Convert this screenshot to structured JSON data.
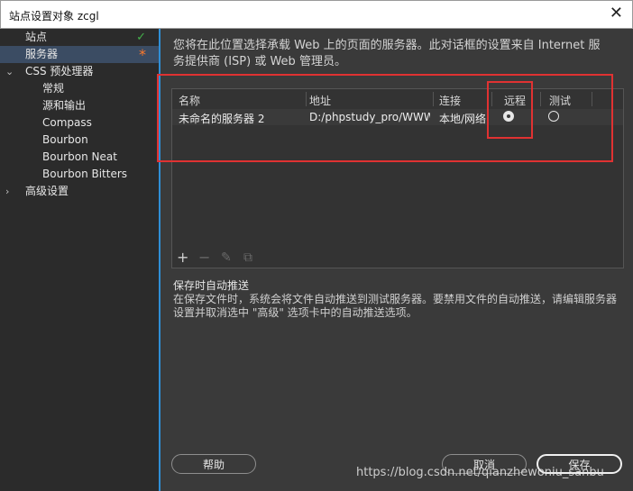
{
  "window": {
    "title": "站点设置对象 zcgl",
    "close_glyph": "✕"
  },
  "sidebar": {
    "items": [
      {
        "label": "站点",
        "mark": "✓"
      },
      {
        "label": "服务器",
        "mark": "*"
      },
      {
        "label": "CSS 预处理器",
        "arrow": "⌄"
      },
      {
        "label": "常规"
      },
      {
        "label": "源和输出"
      },
      {
        "label": "Compass"
      },
      {
        "label": "Bourbon"
      },
      {
        "label": "Bourbon Neat"
      },
      {
        "label": "Bourbon Bitters"
      },
      {
        "label": "高级设置",
        "arrow": "›"
      }
    ]
  },
  "main": {
    "description": "您将在此位置选择承载 Web 上的页面的服务器。此对话框的设置来自 Internet 服务提供商 (ISP) 或 Web 管理员。",
    "table": {
      "headers": {
        "name": "名称",
        "address": "地址",
        "connection": "连接",
        "remote": "远程",
        "testing": "测试"
      },
      "rows": [
        {
          "name": "未命名的服务器 2",
          "address": "D:/phpstudy_pro/WWW...",
          "connection": "本地/网络",
          "remote": true,
          "testing": false
        }
      ]
    },
    "toolbar": {
      "add": "+",
      "remove": "−",
      "edit": "✎",
      "duplicate": "⧉"
    },
    "push": {
      "title": "保存时自动推送",
      "description": "在保存文件时，系统会将文件自动推送到测试服务器。要禁用文件的自动推送，请编辑服务器设置并取消选中 \"高级\" 选项卡中的自动推送选项。"
    },
    "buttons": {
      "help": "帮助",
      "cancel": "取消",
      "save": "保存"
    }
  },
  "watermark": "https://blog.csdn.net/qianzhewoniu_sanbu",
  "colors": {
    "accent_blue": "#2f8fd6",
    "highlight_red": "#e03232",
    "check_green": "#44b04a",
    "asterisk_orange": "#ff7a2b"
  }
}
